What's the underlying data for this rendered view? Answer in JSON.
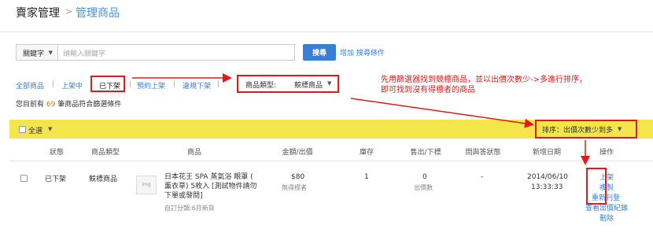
{
  "header": {
    "section": "賣家管理",
    "separator": ">",
    "current": "管理商品"
  },
  "search": {
    "field_select": "關鍵字",
    "placeholder": "請輸入關鍵字",
    "button": "搜尋",
    "add_condition": "增加 搜尋條件"
  },
  "tabs": [
    {
      "label": "全部商品",
      "active": false
    },
    {
      "label": "上架中",
      "active": false
    },
    {
      "label": "已下架",
      "active": true
    },
    {
      "label": "預約上架",
      "active": false
    },
    {
      "label": "違規下架",
      "active": false
    }
  ],
  "tab_separator": "|",
  "product_type_filter": {
    "label": "商品類型:",
    "value": "競標商品"
  },
  "annotation": {
    "line1": "先用篩選器找到競標商品，並以出價次數少->多進行排序，",
    "line2": "即可找到沒有得標者的商品"
  },
  "result_summary": {
    "prefix": "您目前有 ",
    "count": "69",
    "suffix": " 筆商品符合篩選條件"
  },
  "bulk": {
    "select_all": "全選"
  },
  "sort": {
    "label": "排序：出價次數少到多"
  },
  "columns": [
    "狀態",
    "商品類型",
    "商品",
    "金額/出價",
    "庫存",
    "售出/下標",
    "問與答狀態",
    "新增日期",
    "操作"
  ],
  "rows": [
    {
      "status": "已下架",
      "type": "競標商品",
      "thumb": "img",
      "name_lines": [
        "日本花王 SPA 蒸氣浴 眼罩 (",
        "薰衣草) 5枚入 [測試物件請勿",
        "下單或發問]"
      ],
      "category": "自訂分類:6月新貨",
      "price": "$80",
      "price_sub": "無得標者",
      "stock": "1",
      "sold": "0",
      "sold_sub": "出價數",
      "qa": "-",
      "date": "2014/06/10",
      "time": "13:33:33",
      "actions": [
        "上架",
        "複製",
        "重新刊登",
        "查看出價紀錄",
        "刪除"
      ]
    }
  ],
  "colors": {
    "accent": "#3a7fd5",
    "highlight_bar": "#f4e64a",
    "annotation_red": "#e01a1a",
    "count_orange": "#e8760a"
  }
}
